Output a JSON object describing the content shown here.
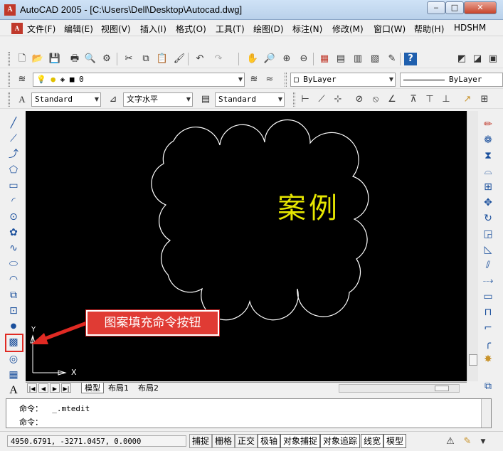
{
  "window": {
    "title": "AutoCAD 2005 - [C:\\Users\\Dell\\Desktop\\Autocad.dwg]",
    "app_icon_glyph": "A",
    "minimize": "‒",
    "maximize": "□",
    "close": "✕"
  },
  "menubar": {
    "items": [
      "文件(F)",
      "编辑(E)",
      "视图(V)",
      "插入(I)",
      "格式(O)",
      "工具(T)",
      "绘图(D)",
      "标注(N)",
      "修改(M)",
      "窗口(W)",
      "帮助(H)",
      "HDSHM"
    ]
  },
  "layers": {
    "current_layer": "0",
    "color": "ByLayer",
    "linetype": "ByLayer"
  },
  "styles": {
    "text_style": "Standard",
    "dim_style": "文字水平",
    "table_style": "Standard"
  },
  "drawing": {
    "text": "案例",
    "text_color": "#e6e600",
    "cloud_color": "#ffffff",
    "ucs_y_label": "Y",
    "ucs_x_label": "X"
  },
  "tabs": {
    "items": [
      "模型",
      "布局1",
      "布局2"
    ],
    "active": "模型",
    "nav": [
      "|◀",
      "◀",
      "▶",
      "▶|"
    ]
  },
  "command": {
    "lines": [
      "命令：  _.mtedit",
      "命令："
    ]
  },
  "status": {
    "coords": "4950.6791, -3271.0457, 0.0000",
    "buttons": [
      "捕捉",
      "栅格",
      "正交",
      "极轴",
      "对象捕捉",
      "对象追踪",
      "线宽",
      "模型"
    ],
    "on_buttons": [
      "极轴",
      "对象捕捉",
      "对象追踪",
      "线宽",
      "模型"
    ]
  },
  "annotation": {
    "callout_text": "图案填充命令按钮",
    "color": "#e03b34"
  },
  "icons": {
    "standard_toolbar": [
      "new-icon",
      "open-icon",
      "save-icon",
      "print-icon",
      "preview-icon",
      "cut-icon",
      "copy-icon",
      "paste-icon",
      "match-icon",
      "undo-icon",
      "redo-icon",
      "pan-icon",
      "zoom-realtime-icon",
      "zoom-window-icon",
      "zoom-previous-icon",
      "properties-icon",
      "design-center-icon",
      "tool-palettes-icon",
      "help-icon"
    ],
    "draw_toolbar": [
      "line-icon",
      "construction-line-icon",
      "polyline-icon",
      "polygon-icon",
      "rectangle-icon",
      "arc-icon",
      "circle-icon",
      "revcloud-icon",
      "spline-icon",
      "ellipse-icon",
      "ellipse-arc-icon",
      "insert-block-icon",
      "make-block-icon",
      "point-icon",
      "hatch-icon",
      "region-icon",
      "table-icon",
      "mtext-icon"
    ],
    "modify_toolbar": [
      "erase-icon",
      "copy-object-icon",
      "mirror-icon",
      "offset-icon",
      "array-icon",
      "move-icon",
      "rotate-icon",
      "scale-icon",
      "stretch-icon",
      "trim-icon",
      "extend-icon",
      "break-point-icon",
      "break-icon",
      "chamfer-icon",
      "fillet-icon",
      "explode-icon"
    ]
  }
}
